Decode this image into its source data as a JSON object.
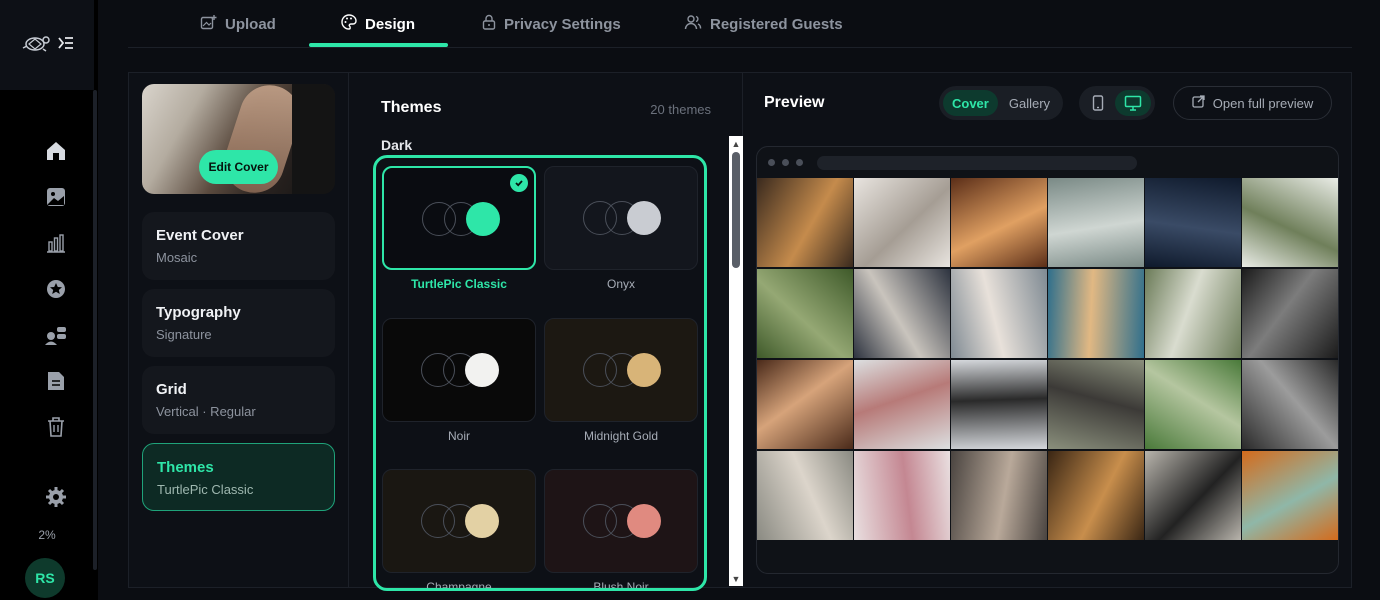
{
  "tabs": [
    {
      "label": "Upload",
      "icon": "upload-image-icon"
    },
    {
      "label": "Design",
      "icon": "palette-icon"
    },
    {
      "label": "Privacy Settings",
      "icon": "lock-icon"
    },
    {
      "label": "Registered Guests",
      "icon": "users-icon"
    }
  ],
  "active_tab": "Design",
  "rail": {
    "logo_icon": "turtle-logo-icon",
    "collapse_icon": "collapse-menu-icon",
    "icons": [
      "home-icon",
      "image-icon",
      "chart-icon",
      "star-icon",
      "guests-icon",
      "document-icon",
      "trash-icon",
      "settings-icon"
    ],
    "storage_percent": "2%",
    "avatar_initials": "RS"
  },
  "settings": {
    "edit_cover_label": "Edit Cover",
    "options": [
      {
        "title": "Event Cover",
        "subtitle": "Mosaic"
      },
      {
        "title": "Typography",
        "subtitle": "Signature"
      },
      {
        "title": "Grid",
        "subtitle": "Vertical · Regular"
      },
      {
        "title": "Themes",
        "subtitle": "TurtlePic Classic",
        "active": true
      }
    ]
  },
  "themes": {
    "title": "Themes",
    "count": "20 themes",
    "group": "Dark",
    "items": [
      {
        "name": "TurtlePic Classic",
        "bg": "#0a0c11",
        "accent": "#2ee6a8",
        "selected": true
      },
      {
        "name": "Onyx",
        "bg": "#13161d",
        "accent": "#c9ccd2",
        "selected": false
      },
      {
        "name": "Noir",
        "bg": "#090909",
        "accent": "#f2f2f0",
        "selected": false
      },
      {
        "name": "Midnight Gold",
        "bg": "#1c1812",
        "accent": "#d8b478",
        "selected": false
      },
      {
        "name": "Champagne",
        "bg": "#1a1712",
        "accent": "#e3d1a4",
        "selected": false
      },
      {
        "name": "Blush Noir",
        "bg": "#1e1416",
        "accent": "#e08a80",
        "selected": false
      }
    ]
  },
  "preview": {
    "title": "Preview",
    "mode_options": [
      "Cover",
      "Gallery"
    ],
    "active_mode": "Cover",
    "device_icons": [
      "mobile-icon",
      "desktop-icon"
    ],
    "active_device": "desktop-icon",
    "open_full_label": "Open full preview",
    "open_full_icon": "external-link-icon"
  },
  "colors": {
    "accent": "#2ee6a8",
    "background": "#0b0d12"
  }
}
